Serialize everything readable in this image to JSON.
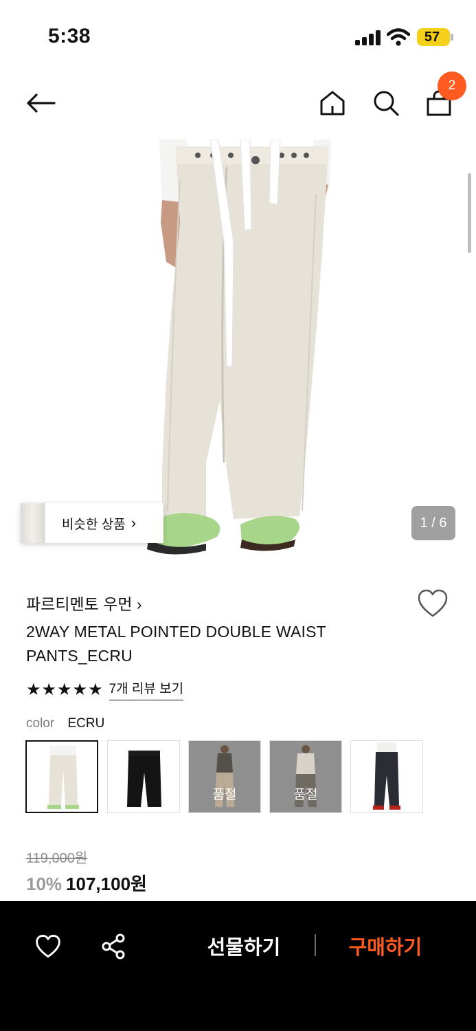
{
  "status_bar": {
    "time": "5:38",
    "battery": "57"
  },
  "header": {
    "cart_count": "2",
    "icons": [
      "back-arrow-icon",
      "home-icon",
      "search-icon",
      "cart-icon"
    ]
  },
  "gallery": {
    "similar_label": "비슷한 상품",
    "page_counter": "1 / 6"
  },
  "product": {
    "brand": "파르티멘토 우먼",
    "title": "2WAY METAL POINTED DOUBLE WAIST PANTS_ECRU",
    "stars": "★★★★★",
    "rating_stars": 5,
    "review_link": "7개 리뷰 보기",
    "color_label": "color",
    "color_value": "ECRU",
    "swatches": [
      {
        "selected": true,
        "sold_out": false
      },
      {
        "selected": false,
        "sold_out": false
      },
      {
        "selected": false,
        "sold_out": true,
        "label": "품절"
      },
      {
        "selected": false,
        "sold_out": true,
        "label": "품절"
      },
      {
        "selected": false,
        "sold_out": false
      }
    ],
    "original_price": "119,000원",
    "discount": "10%",
    "final_price": "107,100원"
  },
  "bottom_bar": {
    "gift_label": "선물하기",
    "buy_label": "구매하기",
    "accent": "#ff5a1f"
  }
}
